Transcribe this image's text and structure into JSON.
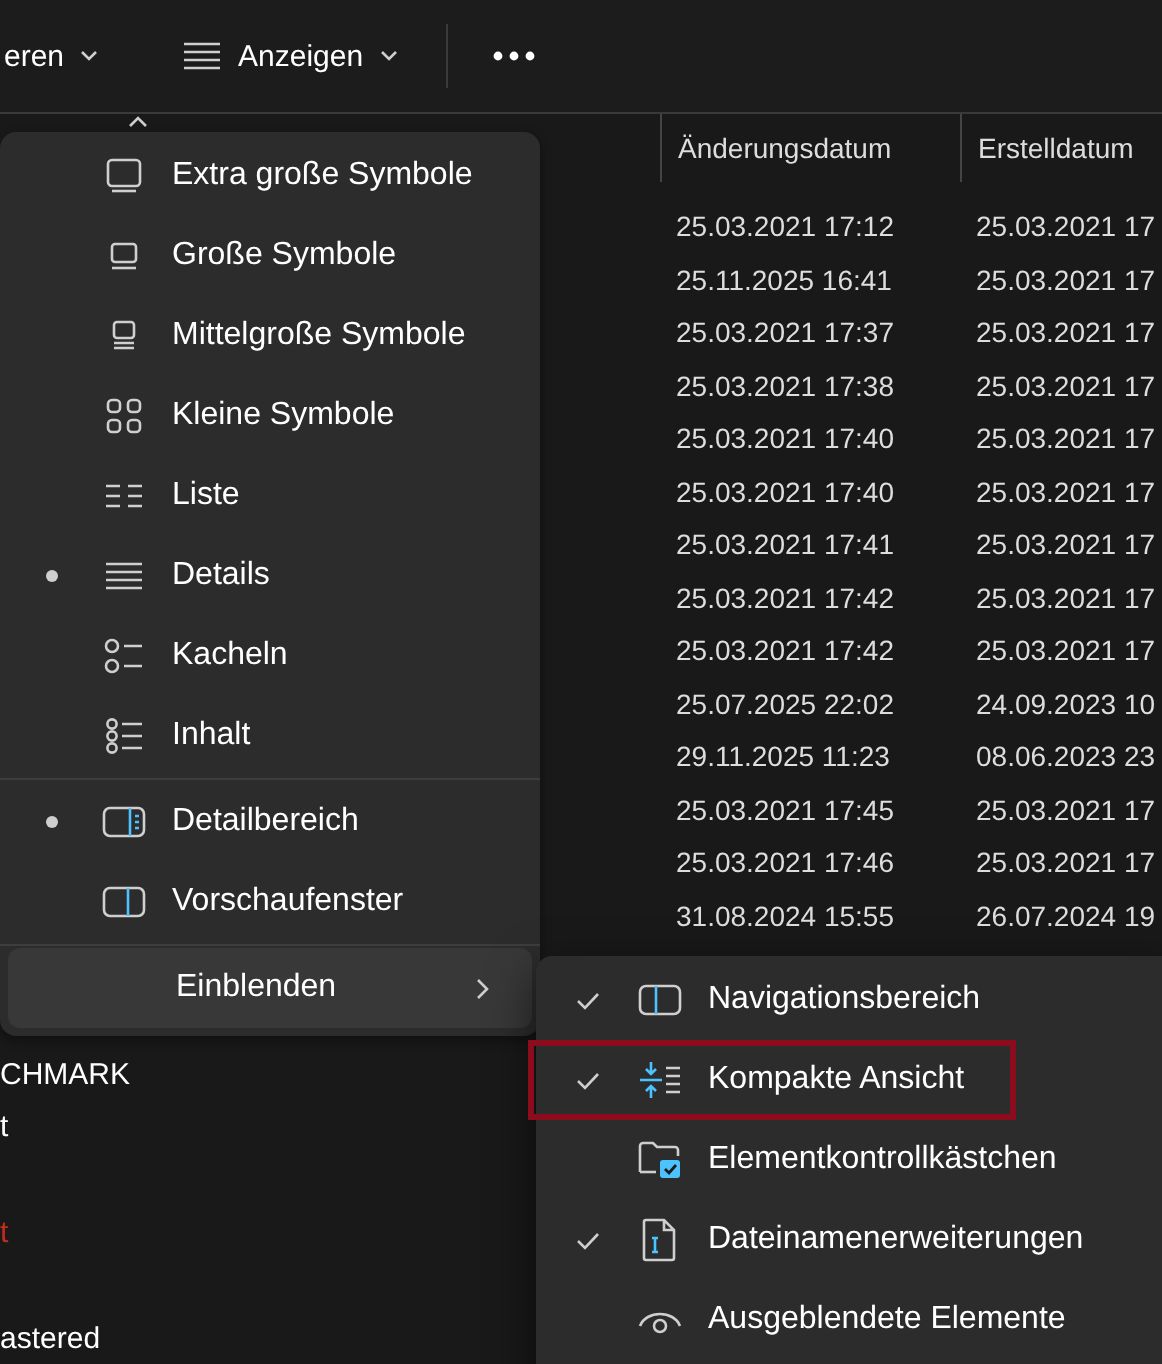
{
  "toolbar": {
    "partial_button": "eren",
    "view_button": "Anzeigen"
  },
  "table": {
    "columns": [
      "Änderungsdatum",
      "Erstelldatum"
    ],
    "rows": [
      {
        "modified": "25.03.2021 17:12",
        "created": "25.03.2021 17"
      },
      {
        "modified": "25.11.2025 16:41",
        "created": "25.03.2021 17"
      },
      {
        "modified": "25.03.2021 17:37",
        "created": "25.03.2021 17"
      },
      {
        "modified": "25.03.2021 17:38",
        "created": "25.03.2021 17"
      },
      {
        "modified": "25.03.2021 17:40",
        "created": "25.03.2021 17"
      },
      {
        "modified": "25.03.2021 17:40",
        "created": "25.03.2021 17"
      },
      {
        "modified": "25.03.2021 17:41",
        "created": "25.03.2021 17"
      },
      {
        "modified": "25.03.2021 17:42",
        "created": "25.03.2021 17"
      },
      {
        "modified": "25.03.2021 17:42",
        "created": "25.03.2021 17"
      },
      {
        "modified": "25.07.2025 22:02",
        "created": "24.09.2023 10"
      },
      {
        "modified": "29.11.2025 11:23",
        "created": "08.06.2023 23"
      },
      {
        "modified": "25.03.2021 17:45",
        "created": "25.03.2021 17"
      },
      {
        "modified": "25.03.2021 17:46",
        "created": "25.03.2021 17"
      },
      {
        "modified": "31.08.2024 15:55",
        "created": "26.07.2024 19"
      },
      {},
      {},
      {
        "name": "CHMARK"
      },
      {
        "name": "t"
      },
      {},
      {
        "name": "t",
        "color": "#c42b1c"
      },
      {},
      {
        "name": "astered"
      }
    ]
  },
  "view_menu": {
    "sections": [
      [
        {
          "kind": "layout",
          "label": "Extra große Symbole",
          "selected": false
        },
        {
          "kind": "layout",
          "label": "Große Symbole",
          "selected": false
        },
        {
          "kind": "layout",
          "label": "Mittelgroße Symbole",
          "selected": false
        },
        {
          "kind": "layout",
          "label": "Kleine Symbole",
          "selected": false
        },
        {
          "kind": "layout",
          "label": "Liste",
          "selected": false
        },
        {
          "kind": "layout",
          "label": "Details",
          "selected": true
        },
        {
          "kind": "layout",
          "label": "Kacheln",
          "selected": false
        },
        {
          "kind": "layout",
          "label": "Inhalt",
          "selected": false
        }
      ],
      [
        {
          "kind": "pane",
          "label": "Detailbereich",
          "selected": true
        },
        {
          "kind": "pane",
          "label": "Vorschaufenster",
          "selected": false
        }
      ],
      [
        {
          "kind": "submenu",
          "label": "Einblenden",
          "expanded": true
        }
      ]
    ]
  },
  "show_submenu": {
    "items": [
      {
        "label": "Navigationsbereich",
        "checked": true,
        "highlighted": false
      },
      {
        "label": "Kompakte Ansicht",
        "checked": true,
        "highlighted": true
      },
      {
        "label": "Elementkontrollkästchen",
        "checked": false,
        "highlighted": false
      },
      {
        "label": "Dateinamenerweiterungen",
        "checked": true,
        "highlighted": false
      },
      {
        "label": "Ausgeblendete Elemente",
        "checked": false,
        "highlighted": false
      }
    ]
  }
}
